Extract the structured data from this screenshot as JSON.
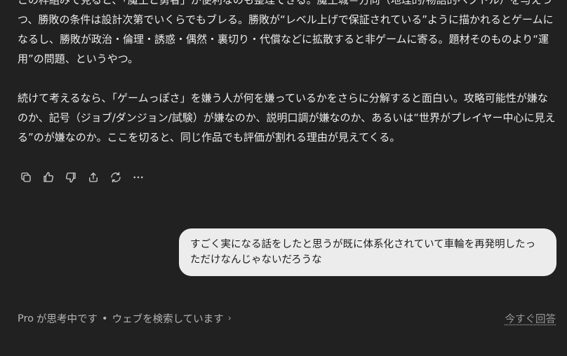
{
  "assistant": {
    "paragraph1": "この枠組みで見ると、「魔王と勇者」が便利なのも整理できる。魔王城＝方向（地理的/物語的ベクトル）を与えつつ、勝敗の条件は設計次第でいくらでもブレる。勝敗が“レベル上げで保証されている”ように描かれるとゲームになるし、勝敗が政治・倫理・誘惑・偶然・裏切り・代償などに拡散すると非ゲームに寄る。題材そのものより“運用”の問題、というやつ。",
    "paragraph2": "続けて考えるなら、「ゲームっぽさ」を嫌う人が何を嫌っているかをさらに分解すると面白い。攻略可能性が嫌なのか、記号（ジョブ/ダンジョン/試験）が嫌なのか、説明口調が嫌なのか、あるいは“世界がプレイヤー中心に見える”のが嫌なのか。ここを切ると、同じ作品でも評価が割れる理由が見えてくる。"
  },
  "actions": {
    "copy": "copy-icon",
    "like": "thumbs-up-icon",
    "dislike": "thumbs-down-icon",
    "share": "share-icon",
    "regenerate": "regenerate-icon",
    "more": "more-icon"
  },
  "user": {
    "message": "すごく実になる話をしたと思うが既に体系化されていて車輪を再発明したっただけなんじゃないだろうな"
  },
  "status": {
    "pro_label": "Pro",
    "thinking": "が思考中です",
    "separator": "•",
    "searching": "ウェブを検索しています",
    "chevron": "›",
    "answer_now": "今すぐ回答"
  }
}
